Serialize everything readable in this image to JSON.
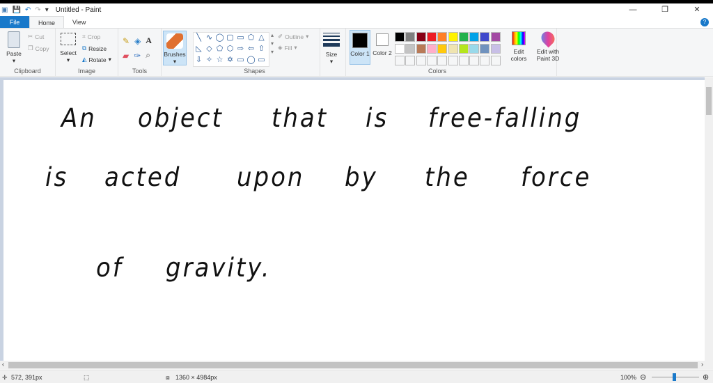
{
  "window": {
    "title": "Untitled - Paint",
    "minimize": "—",
    "maximize": "❐",
    "close": "✕"
  },
  "tabs": [
    {
      "label": "File"
    },
    {
      "label": "Home"
    },
    {
      "label": "View"
    }
  ],
  "ribbon": {
    "clipboard": {
      "label": "Clipboard",
      "paste": "Paste",
      "cut": "Cut",
      "copy": "Copy"
    },
    "image": {
      "label": "Image",
      "select": "Select",
      "crop": "Crop",
      "resize": "Resize",
      "rotate": "Rotate"
    },
    "tools": {
      "label": "Tools"
    },
    "brushes": "Brushes",
    "shapes": {
      "label": "Shapes",
      "outline": "Outline",
      "fill": "Fill",
      "glyphs": [
        "╲",
        "∿",
        "◯",
        "▢",
        "▭",
        "⬠",
        "△",
        "◺",
        "◇",
        "⬠",
        "⬡",
        "⇨",
        "⇦",
        "⇧",
        "⇩",
        "✧",
        "☆",
        "✡",
        "▭",
        "◯",
        "▭"
      ]
    },
    "size": "Size",
    "colors": {
      "label": "Colors",
      "color1": "Color 1",
      "color2": "Color 2",
      "edit": "Edit colors",
      "paint3d": "Edit with Paint 3D",
      "row1": [
        "#000000",
        "#7f7f7f",
        "#880015",
        "#ed1c24",
        "#ff7f27",
        "#fff200",
        "#22b14c",
        "#00a2e8",
        "#3f48cc",
        "#a349a4"
      ],
      "row2": [
        "#ffffff",
        "#c3c3c3",
        "#b97a57",
        "#ffaec9",
        "#ffc90e",
        "#efe4b0",
        "#b5e61d",
        "#99d9ea",
        "#7092be",
        "#c8bfe7"
      ]
    }
  },
  "canvas": {
    "lines": [
      [
        "An",
        "object",
        "that",
        "is",
        "free-falling"
      ],
      [
        "is",
        "acted",
        "upon",
        "by",
        "the",
        "force"
      ],
      [
        "of",
        "gravity."
      ]
    ]
  },
  "status": {
    "cursor": "572, 391px",
    "size": "1360 × 4984px",
    "zoom": "100%"
  }
}
